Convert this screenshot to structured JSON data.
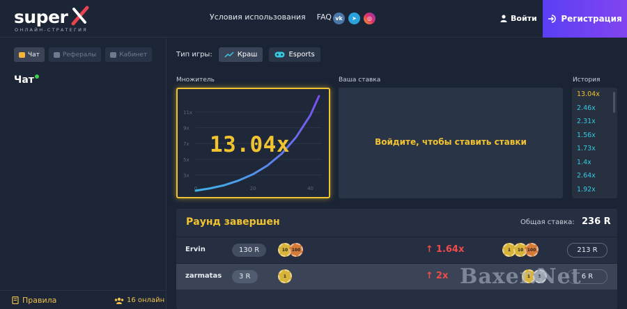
{
  "header": {
    "logo_text": "super",
    "logo_sub": "ОНЛАЙН-СТРАТЕГИЯ",
    "nav": [
      "Условия использования",
      "FAQ"
    ],
    "socials": [
      {
        "icon": "vk-icon",
        "glyph": "vk"
      },
      {
        "icon": "telegram-icon",
        "glyph": "➤"
      },
      {
        "icon": "instagram-icon",
        "glyph": "◎"
      }
    ],
    "login_label": "Войти",
    "register_label": "Регистрация"
  },
  "sidebar": {
    "tabs": [
      {
        "label": "Чат",
        "active": true
      },
      {
        "label": "Рефералы",
        "active": false
      },
      {
        "label": "Кабинет",
        "active": false
      }
    ],
    "chat_title": "Чат",
    "rules_label": "Правила",
    "online_label": "16 онлайн"
  },
  "game": {
    "type_label": "Тип игры:",
    "types": [
      {
        "label": "Краш",
        "active": true,
        "icon": "chart-line-icon"
      },
      {
        "label": "Esports",
        "active": false,
        "icon": "gamepad-icon"
      }
    ],
    "multiplier_label": "Множитель",
    "multiplier_value": "13.04x",
    "bet_label": "Ваша ставка",
    "bet_message": "Войдите, чтобы ставить ставки",
    "history_label": "История",
    "history": [
      "13.04x",
      "2.46x",
      "2.31x",
      "1.56x",
      "1.73x",
      "1.4x",
      "2.64x",
      "1.92x"
    ]
  },
  "chart_data": {
    "type": "line",
    "x_ticks": [
      "0",
      "20",
      "40"
    ],
    "y_ticks": [
      "3x",
      "5x",
      "7x",
      "9x",
      "11x"
    ],
    "xlim": [
      0,
      44
    ],
    "ylim": [
      1,
      13.04
    ],
    "series": [
      {
        "x": [
          0,
          5,
          10,
          15,
          20,
          25,
          30,
          35,
          40,
          43
        ],
        "values": [
          1,
          1.3,
          1.7,
          2.3,
          3.1,
          4.2,
          5.7,
          7.8,
          10.6,
          13.04
        ]
      }
    ]
  },
  "round": {
    "title": "Раунд завершен",
    "total_label": "Общая ставка:",
    "total_value": "236 R",
    "rows": [
      {
        "name": "Ervin",
        "bet": "130 R",
        "bet_chips": [
          "10",
          "100"
        ],
        "mult": "1.64x",
        "win_chips": [
          "1",
          "10",
          "100"
        ],
        "win": "213 R"
      },
      {
        "name": "zarmatas",
        "bet": "3 R",
        "bet_chips": [
          "1"
        ],
        "mult": "2x",
        "win_chips": [
          "1",
          "5"
        ],
        "win": "6 R"
      }
    ]
  },
  "watermark": "Baxer.Net"
}
